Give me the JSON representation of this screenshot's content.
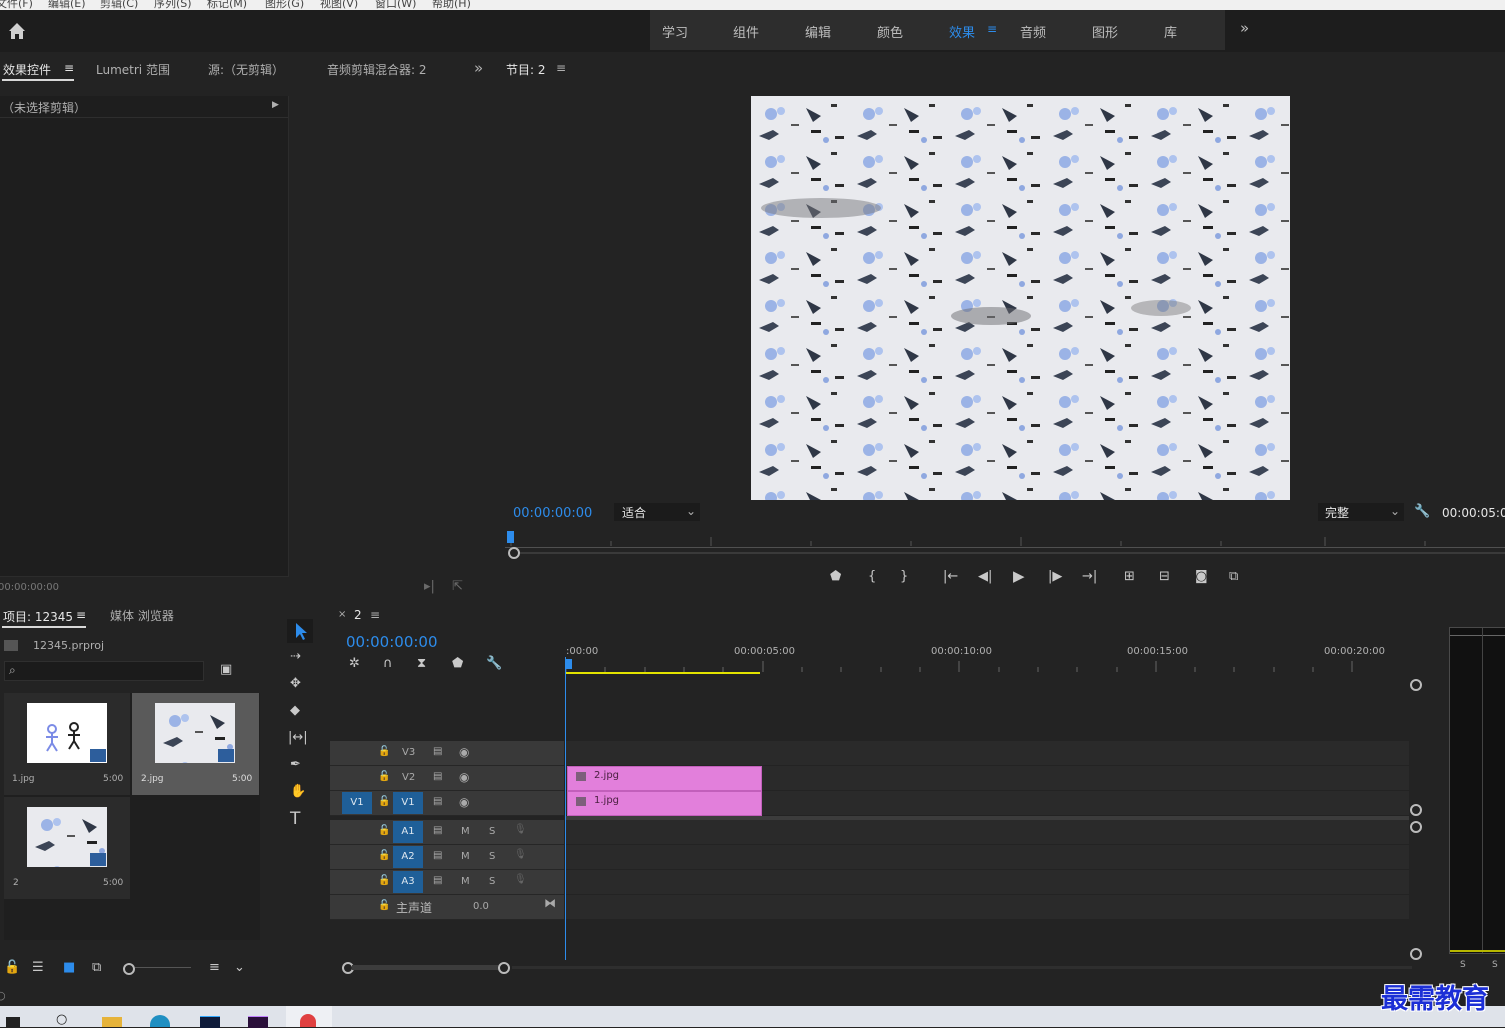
{
  "menu": [
    "文件(F)",
    "编辑(E)",
    "剪辑(C)",
    "序列(S)",
    "标记(M)",
    "图形(G)",
    "视图(V)",
    "窗口(W)",
    "帮助(H)"
  ],
  "workspaces": {
    "items": [
      "学习",
      "组件",
      "编辑",
      "颜色",
      "效果",
      "音频",
      "图形",
      "库"
    ],
    "active": "效果",
    "overflow": "»"
  },
  "effect_panel": {
    "tabs": [
      "效果控件",
      "Lumetri 范围",
      "源:（无剪辑）",
      "音频剪辑混合器: 2"
    ],
    "menu_glyph": "≡",
    "overflow": "»",
    "no_clip": "（未选择剪辑）",
    "timecode": "00:00:00:00"
  },
  "program": {
    "title": "节目: 2",
    "menu_glyph": "≡",
    "timecode": "00:00:00:00",
    "fit": "适合",
    "quality": "完整",
    "duration": "00:00:05:0"
  },
  "project": {
    "tabs": [
      "项目: 12345",
      "媒体 浏览器"
    ],
    "menu_glyph": "≡",
    "file": "12345.prproj",
    "items": [
      {
        "name": "1.jpg",
        "duration": "5:00"
      },
      {
        "name": "2.jpg",
        "duration": "5:00"
      },
      {
        "name": "2",
        "duration": "5:00"
      }
    ]
  },
  "timeline": {
    "tab": "2",
    "close": "×",
    "menu_glyph": "≡",
    "timecode": "00:00:00:00",
    "ruler": [
      ":00:00",
      "00:00:05:00",
      "00:00:10:00",
      "00:00:15:00",
      "00:00:20:00"
    ],
    "video_tracks": [
      {
        "label": "V3"
      },
      {
        "label": "V2",
        "clip": "2.jpg"
      },
      {
        "label": "V1",
        "source": "V1",
        "clip": "1.jpg"
      }
    ],
    "audio_tracks": [
      {
        "label": "A1",
        "m": "M",
        "s": "S"
      },
      {
        "label": "A2",
        "m": "M",
        "s": "S"
      },
      {
        "label": "A3",
        "m": "M",
        "s": "S"
      }
    ],
    "master": {
      "label": "主声道",
      "value": "0.0"
    }
  },
  "meter": {
    "s1": "S",
    "s2": "S"
  },
  "watermark": "最需教育",
  "colors": {
    "accent": "#2d8ceb",
    "clip": "#e27fdb",
    "track_target": "#1f5f98",
    "work_area": "#e3e300"
  }
}
